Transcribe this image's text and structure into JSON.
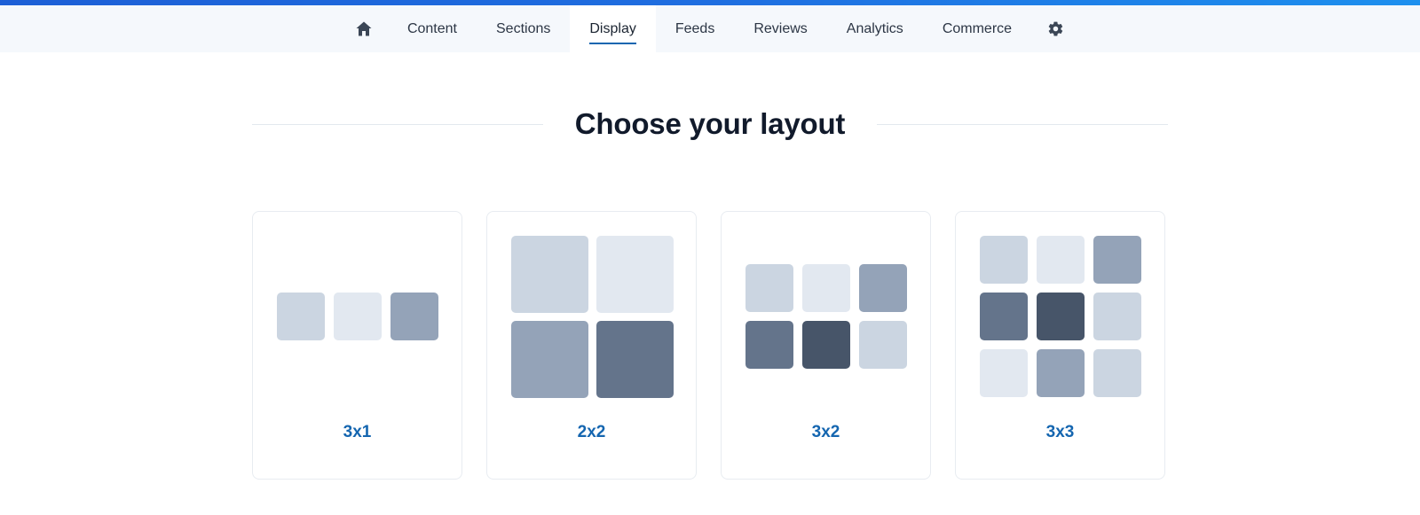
{
  "nav": {
    "items": [
      {
        "type": "icon",
        "icon": "home-icon",
        "label": ""
      },
      {
        "type": "text",
        "label": "Content"
      },
      {
        "type": "text",
        "label": "Sections"
      },
      {
        "type": "text",
        "label": "Display",
        "active": true
      },
      {
        "type": "text",
        "label": "Feeds"
      },
      {
        "type": "text",
        "label": "Reviews"
      },
      {
        "type": "text",
        "label": "Analytics"
      },
      {
        "type": "text",
        "label": "Commerce"
      },
      {
        "type": "icon",
        "icon": "gear-icon",
        "label": ""
      }
    ]
  },
  "page": {
    "title": "Choose your layout"
  },
  "layouts": [
    {
      "label": "3x1"
    },
    {
      "label": "2x2"
    },
    {
      "label": "3x2"
    },
    {
      "label": "3x3"
    }
  ],
  "colors": {
    "accent": "#1566b0",
    "tile_shades": [
      "#cbd5e1",
      "#e2e8f0",
      "#94a3b8",
      "#64748b",
      "#475569"
    ]
  }
}
